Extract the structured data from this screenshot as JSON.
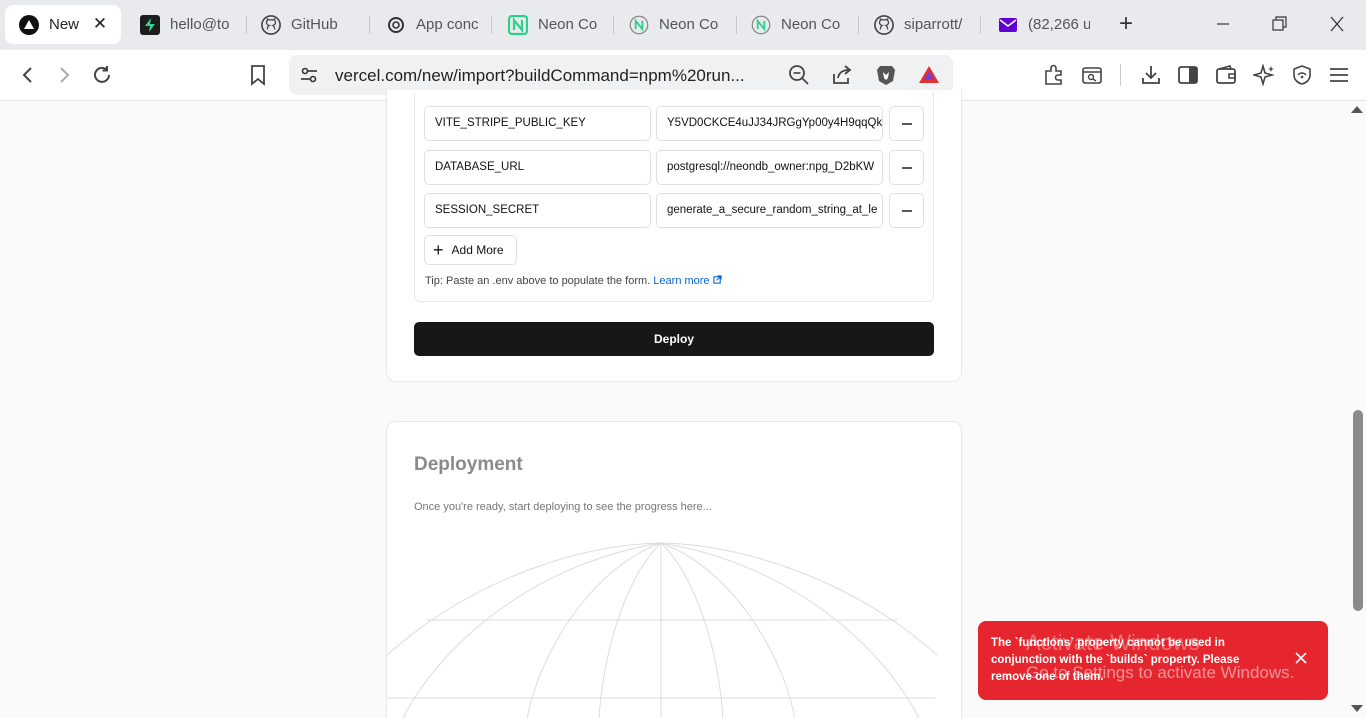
{
  "tabs": [
    {
      "title": "New",
      "icon": "vercel-icon",
      "active": true
    },
    {
      "title": "hello@to",
      "icon": "supabase-icon"
    },
    {
      "title": "GitHub",
      "icon": "github-icon"
    },
    {
      "title": "App conc",
      "icon": "openai-icon"
    },
    {
      "title": "Neon Co",
      "icon": "neon-icon"
    },
    {
      "title": "Neon Co",
      "icon": "neon-icon"
    },
    {
      "title": "Neon Co",
      "icon": "neon-icon"
    },
    {
      "title": "siparrott/",
      "icon": "github-icon"
    },
    {
      "title": "(82,266 u",
      "icon": "mail-icon"
    }
  ],
  "address_bar": {
    "url": "vercel.com/new/import?buildCommand=npm%20run..."
  },
  "env_vars": [
    {
      "key": "VITE_STRIPE_PUBLIC_KEY",
      "value": "Y5VD0CKCE4uJJ34JRGgYp00y4H9qqQk"
    },
    {
      "key": "DATABASE_URL",
      "value": "postgresql://neondb_owner:npg_D2bKW"
    },
    {
      "key": "SESSION_SECRET",
      "value": "generate_a_secure_random_string_at_le"
    }
  ],
  "add_more_label": "Add More",
  "tip": {
    "text": "Tip: Paste an .env above to populate the form.",
    "link": "Learn more"
  },
  "deploy_label": "Deploy",
  "deployment": {
    "title": "Deployment",
    "subtitle": "Once you're ready, start deploying to see the progress here..."
  },
  "toast": {
    "message": "The `functions` property cannot be used in conjunction with the `builds` property. Please remove one of them."
  },
  "watermark": {
    "line1": "Activate Windows",
    "line2": "Go to Settings to activate Windows."
  },
  "colors": {
    "toast_bg": "#e5262e",
    "deploy_bg": "#171717",
    "link": "#0a66c8"
  }
}
